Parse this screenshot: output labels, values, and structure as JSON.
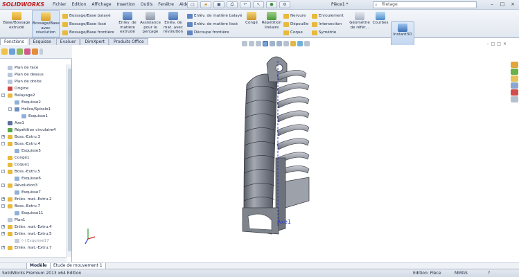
{
  "app": {
    "logo": "SOLIDWORKS",
    "doc_title": "Pièce1 *",
    "window_controls": [
      "–",
      "□",
      "×"
    ]
  },
  "menu": [
    "Fichier",
    "Edition",
    "Affichage",
    "Insertion",
    "Outils",
    "Fenêtre",
    "Aide"
  ],
  "quick_access": [
    "new-icon",
    "open-icon",
    "save-icon",
    "print-icon",
    "undo-icon",
    "select-icon",
    "rebuild-icon",
    "options-icon"
  ],
  "search": {
    "value": "filetage"
  },
  "toolbar": {
    "large": [
      {
        "label": "Base/Bossage extrudé",
        "icon": "extrude-icon"
      },
      {
        "label": "Bossage/Base avec révolution",
        "icon": "revolve-icon"
      },
      {
        "label": "Enlèv. de matière extrudé",
        "icon": "extrude-cut-icon"
      },
      {
        "label": "Assistance pour le perçage",
        "icon": "hole-wizard-icon"
      },
      {
        "label": "Enlèv. de mat. avec révolution",
        "icon": "revolve-cut-icon"
      },
      {
        "label": "Congé",
        "icon": "fillet-icon"
      },
      {
        "label": "Répétition linéaire",
        "icon": "linear-pattern-icon"
      },
      {
        "label": "Géométrie de référ...",
        "icon": "reference-geometry-icon"
      },
      {
        "label": "Courbes",
        "icon": "curves-icon"
      },
      {
        "label": "Instant3D",
        "icon": "instant3d-icon"
      }
    ],
    "small_boss": [
      "Bossage/Base balayé",
      "Bossage/Base lissé",
      "Bossage/Base frontière"
    ],
    "small_cut": [
      "Enlèv. de matière balayé",
      "Enlèv. de matière lissé",
      "Découpe frontière"
    ],
    "small_misc": [
      "Nervure",
      "Dépouille",
      "Coque",
      "Enroulement",
      "Intersection",
      "Symétrie"
    ]
  },
  "command_tabs": [
    "Fonctions",
    "Esquisse",
    "Evaluer",
    "DimXpert",
    "Produits Office"
  ],
  "panel_icons": [
    "feature-manager-icon",
    "property-manager-icon",
    "configuration-manager-icon",
    "dimxpert-manager-icon",
    "display-manager-icon"
  ],
  "tree": [
    {
      "label": "Plan de face",
      "indent": 0,
      "icon": "plane",
      "expand": ""
    },
    {
      "label": "Plan de dessus",
      "indent": 0,
      "icon": "plane",
      "expand": ""
    },
    {
      "label": "Plan de droite",
      "indent": 0,
      "icon": "plane",
      "expand": ""
    },
    {
      "label": "Origine",
      "indent": 0,
      "icon": "origin",
      "expand": ""
    },
    {
      "label": "Balayage2",
      "indent": 0,
      "icon": "feature",
      "expand": "-"
    },
    {
      "label": "Esquisse2",
      "indent": 1,
      "icon": "sketch",
      "expand": ""
    },
    {
      "label": "Hélice/Spirale1",
      "indent": 1,
      "icon": "helix",
      "expand": "-"
    },
    {
      "label": "Esquisse1",
      "indent": 2,
      "icon": "sketch",
      "expand": ""
    },
    {
      "label": "Axe1",
      "indent": 0,
      "icon": "axis",
      "expand": ""
    },
    {
      "label": "Répétition circulaire4",
      "indent": 0,
      "icon": "pattern",
      "expand": ""
    },
    {
      "label": "Boss.-Extru.3",
      "indent": 0,
      "icon": "feature",
      "expand": "+"
    },
    {
      "label": "Boss.-Extru.4",
      "indent": 0,
      "icon": "feature",
      "expand": "-"
    },
    {
      "label": "Esquisse5",
      "indent": 1,
      "icon": "sketch",
      "expand": ""
    },
    {
      "label": "Congé1",
      "indent": 0,
      "icon": "fillet",
      "expand": ""
    },
    {
      "label": "Coque1",
      "indent": 0,
      "icon": "shell",
      "expand": ""
    },
    {
      "label": "Boss.-Extru.5",
      "indent": 0,
      "icon": "feature",
      "expand": "-"
    },
    {
      "label": "Esquisse6",
      "indent": 1,
      "icon": "sketch",
      "expand": ""
    },
    {
      "label": "Révolution3",
      "indent": 0,
      "icon": "revolve",
      "expand": "-"
    },
    {
      "label": "Esquisse7",
      "indent": 1,
      "icon": "sketch",
      "expand": ""
    },
    {
      "label": "Enlèv. mat.-Extru.2",
      "indent": 0,
      "icon": "cut",
      "expand": "+"
    },
    {
      "label": "Boss.-Extru.7",
      "indent": 0,
      "icon": "feature",
      "expand": "-"
    },
    {
      "label": "Esquisse11",
      "indent": 1,
      "icon": "sketch",
      "expand": ""
    },
    {
      "label": "Plan1",
      "indent": 0,
      "icon": "plane",
      "expand": ""
    },
    {
      "label": "Enlèv. mat.-Extru.4",
      "indent": 0,
      "icon": "cut",
      "expand": "+"
    },
    {
      "label": "Enlèv. mat.-Extru.5",
      "indent": 0,
      "icon": "cut",
      "expand": "+"
    },
    {
      "label": "(-) Esquisse17",
      "indent": 1,
      "icon": "sketch-grey",
      "expand": ""
    },
    {
      "label": "Enlèv. mat.-Extru.7",
      "indent": 0,
      "icon": "cut",
      "expand": "+"
    }
  ],
  "headsup_icons": [
    "zoom-fit-icon",
    "zoom-area-icon",
    "previous-view-icon",
    "section-view-icon",
    "view-orientation-icon",
    "display-style-icon",
    "hide-show-icon",
    "edit-appearance-icon",
    "scene-icon",
    "view-settings-icon"
  ],
  "viewport_controls": [
    "–",
    "□",
    "□",
    "×"
  ],
  "task_pane_icons": [
    "resources-icon",
    "design-library-icon",
    "file-explorer-icon",
    "view-palette-icon",
    "appearances-icon",
    "custom-properties-icon"
  ],
  "model": {
    "axis_label": "Axe1"
  },
  "bottom_tabs": [
    "Modèle",
    "Etude de mouvement 1"
  ],
  "status": {
    "left": "SolidWorks Premium 2013 x64 Edition",
    "mode": "Edition: Pièce",
    "units": "MMGS",
    "help": "?"
  },
  "colors": {
    "accent": "#2c3fd0",
    "brand": "#c31d1d",
    "part_grey": "#7b7f88"
  }
}
